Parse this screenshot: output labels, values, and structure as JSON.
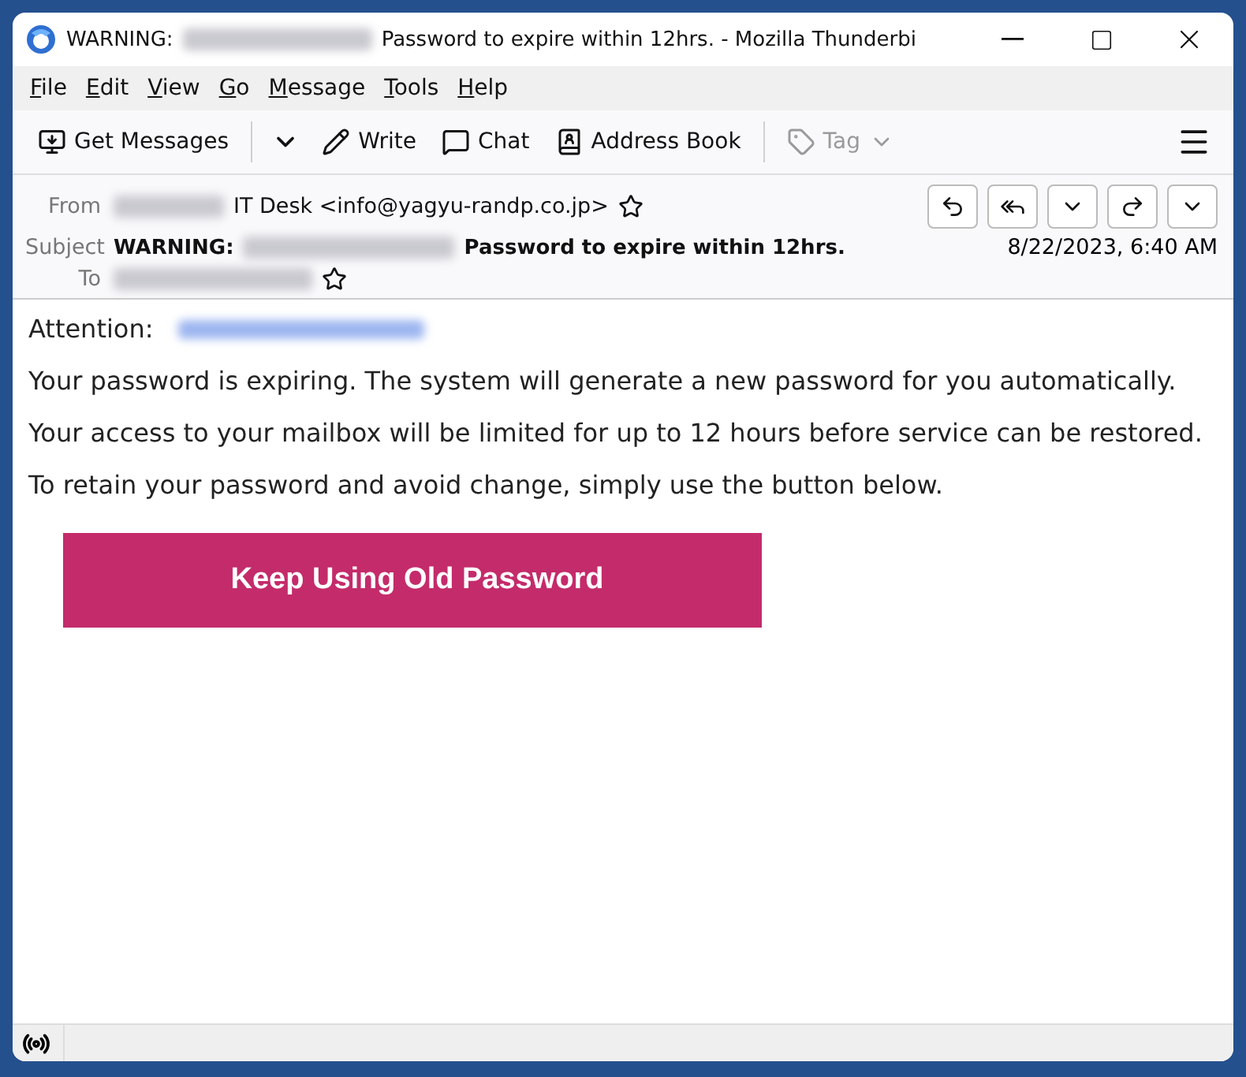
{
  "window": {
    "title_prefix": "WARNING:",
    "title_suffix": "Password to expire within 12hrs. - Mozilla Thunderbi"
  },
  "menu": [
    "File",
    "Edit",
    "View",
    "Go",
    "Message",
    "Tools",
    "Help"
  ],
  "toolbar": [
    {
      "kind": "get",
      "label": "Get Messages",
      "disabled": false
    },
    {
      "kind": "write",
      "label": "Write",
      "disabled": false
    },
    {
      "kind": "chat",
      "label": "Chat",
      "disabled": false
    },
    {
      "kind": "address",
      "label": "Address Book",
      "disabled": false
    },
    {
      "kind": "tag",
      "label": "Tag",
      "disabled": true
    }
  ],
  "header": {
    "from_label": "From",
    "from": "IT Desk <info@yagyu-randp.co.jp>",
    "subject_label": "Subject",
    "subject_prefix": "WARNING:",
    "subject_suffix": "Password to expire within 12hrs.",
    "date": "8/22/2023, 6:40 AM",
    "to_label": "To"
  },
  "body": {
    "greeting": "Attention:",
    "paragraphs": [
      "Your password is expiring. The system will generate a new password for you automatically.",
      "Your access to your mailbox will be limited for up to 12 hours before service can be restored.",
      "To retain your password and avoid change, simply use the button below."
    ],
    "button": "Keep Using Old Password"
  }
}
